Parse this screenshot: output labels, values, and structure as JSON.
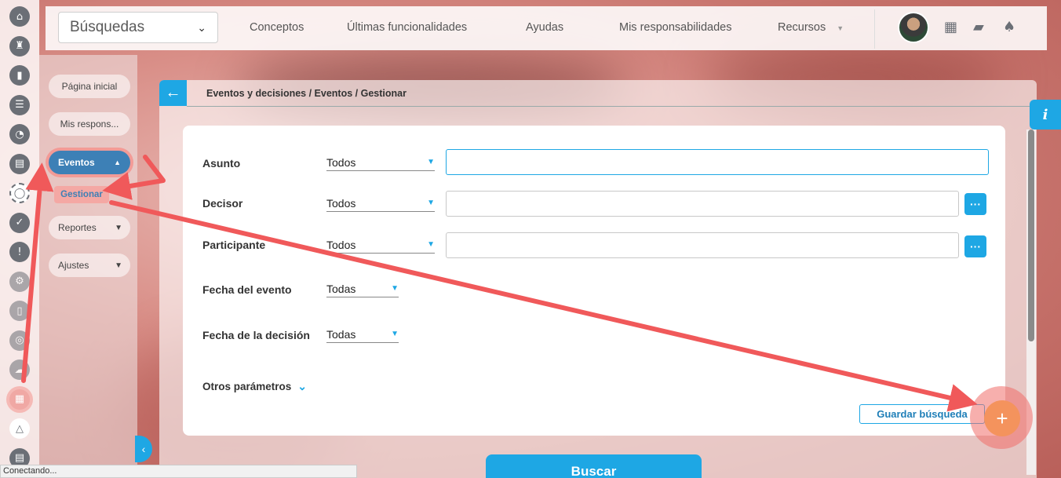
{
  "topbar": {
    "search_select": "Búsquedas",
    "nav": [
      "Conceptos",
      "Últimas funcionalidades",
      "Ayudas",
      "Mis responsabilidades",
      "Recursos"
    ],
    "icons": [
      "avatar",
      "calendar-icon",
      "book-icon",
      "bell-icon"
    ]
  },
  "rail": {
    "icons": [
      "home-icon",
      "chess-rook-icon",
      "bar-chart-icon",
      "list-icon",
      "pie-chart-icon",
      "document-icon",
      "cycle-icon",
      "check-circle-icon",
      "warning-icon",
      "cog-icon",
      "clipboard-icon",
      "target-icon",
      "cloud-icon",
      "calendar-icon",
      "network-icon",
      "file-icon"
    ]
  },
  "sidebar": {
    "pagina_inicial": "Página inicial",
    "mis_respons": "Mis respons...",
    "eventos": "Eventos",
    "gestionar": "Gestionar",
    "reportes": "Reportes",
    "ajustes": "Ajustes"
  },
  "panel": {
    "breadcrumb": "Eventos y decisiones / Eventos / Gestionar"
  },
  "form": {
    "asunto": {
      "label": "Asunto",
      "value": "Todos"
    },
    "decisor": {
      "label": "Decisor",
      "value": "Todos"
    },
    "participante": {
      "label": "Participante",
      "value": "Todos"
    },
    "fecha_evento": {
      "label": "Fecha del evento",
      "value": "Todas"
    },
    "fecha_decision": {
      "label": "Fecha de la decisión",
      "value": "Todas"
    },
    "otros": "Otros parámetros",
    "guardar": "Guardar búsqueda",
    "buscar": "Buscar"
  },
  "status": "Conectando...",
  "colors": {
    "accent": "#1ea7e4",
    "active_nav": "#3d80b6",
    "fab": "#f4935d",
    "annotation_arrow": "#f0595a"
  }
}
